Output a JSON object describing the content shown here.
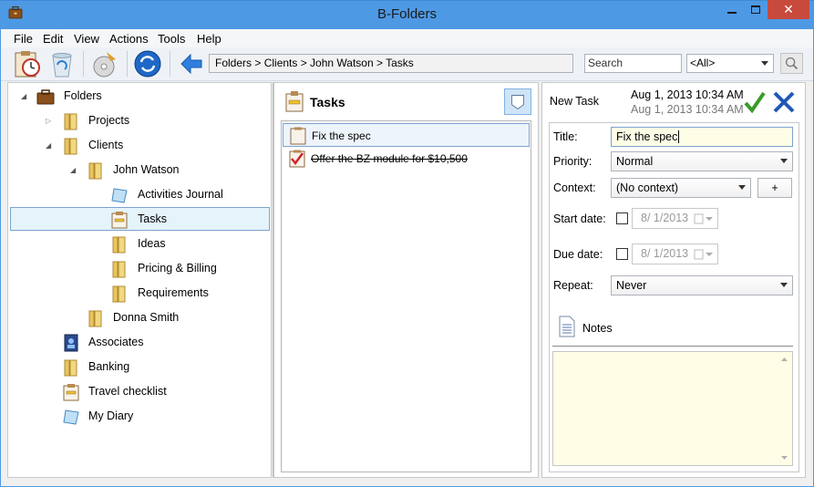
{
  "window": {
    "title": "B-Folders",
    "close_glyph": "✕"
  },
  "menu": [
    "File",
    "Edit",
    "View",
    "Actions",
    "Tools",
    "Help"
  ],
  "toolbar": {
    "path": "Folders > Clients > John Watson > Tasks",
    "search_placeholder": "Search",
    "filter_value": "<All>"
  },
  "tree": {
    "root": "Folders",
    "projects": "Projects",
    "clients": "Clients",
    "john": "John Watson",
    "activities": "Activities Journal",
    "tasks": "Tasks",
    "ideas": "Ideas",
    "pricing": "Pricing & Billing",
    "requirements": "Requirements",
    "donna": "Donna Smith",
    "associates": "Associates",
    "banking": "Banking",
    "travel": "Travel checklist",
    "diary": "My Diary"
  },
  "tasks_panel": {
    "title": "Tasks",
    "items": [
      {
        "label": "Fix the spec",
        "done": false
      },
      {
        "label": "Offer the BZ module for $10,500",
        "done": true
      }
    ]
  },
  "detail": {
    "header": "New Task",
    "created": "Aug 1, 2013 10:34 AM",
    "modified": "Aug 1, 2013 10:34 AM",
    "title_label": "Title:",
    "title_value": "Fix the spec",
    "priority_label": "Priority:",
    "priority_value": "Normal",
    "context_label": "Context:",
    "context_value": "(No context)",
    "context_add": "+",
    "start_label": "Start date:",
    "start_value": "8/  1/2013",
    "due_label": "Due date:",
    "due_value": "8/  1/2013",
    "repeat_label": "Repeat:",
    "repeat_value": "Never",
    "notes_label": "Notes"
  },
  "colors": {
    "titlebar": "#4e99e4",
    "close": "#c74a3d",
    "selection": "#e5f3fb",
    "notes_bg": "#fefee6",
    "ok_check": "#3a9a2a",
    "cancel_x": "#1f58b8"
  }
}
